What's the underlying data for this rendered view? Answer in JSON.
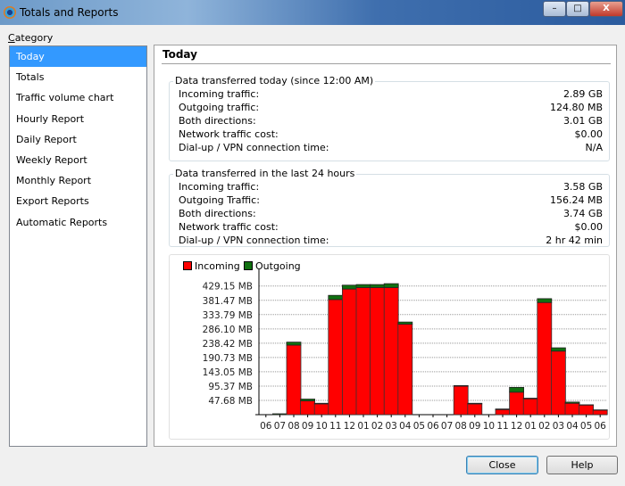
{
  "window": {
    "title": "Totals and Reports",
    "minimize": "–",
    "maximize": "□",
    "close": "X"
  },
  "sidebar": {
    "label_first": "C",
    "label_rest": "ategory",
    "items": [
      "Today",
      "Totals",
      "Traffic volume chart",
      "Hourly Report",
      "Daily Report",
      "Weekly Report",
      "Monthly Report",
      "Export Reports",
      "Automatic Reports"
    ],
    "selected": 0
  },
  "panel": {
    "title": "Today",
    "today": {
      "title": "Data transferred today (since 12:00 AM)",
      "rows": [
        [
          "Incoming traffic:",
          "2.89 GB"
        ],
        [
          "Outgoing traffic:",
          "124.80 MB"
        ],
        [
          "Both directions:",
          "3.01 GB"
        ],
        [
          "Network traffic cost:",
          "$0.00"
        ],
        [
          "Dial-up / VPN connection time:",
          "N/A"
        ]
      ]
    },
    "last24": {
      "title": "Data transferred in the last 24 hours",
      "rows": [
        [
          "Incoming traffic:",
          "3.58 GB"
        ],
        [
          "Outgoing Traffic:",
          "156.24 MB"
        ],
        [
          "Both directions:",
          "3.74 GB"
        ],
        [
          "Network traffic cost:",
          "$0.00"
        ],
        [
          "Dial-up / VPN connection time:",
          "2 hr 42 min"
        ]
      ]
    }
  },
  "colors": {
    "incoming": "#ff0000",
    "outgoing": "#107010"
  },
  "chart_data": {
    "type": "bar",
    "stacked": true,
    "title": "",
    "xlabel": "",
    "ylabel": "",
    "legend": [
      "Incoming",
      "Outgoing"
    ],
    "legend_position": "top-left",
    "categories": [
      "06",
      "07",
      "08",
      "09",
      "10",
      "11",
      "12",
      "01",
      "02",
      "03",
      "04",
      "05",
      "06",
      "07",
      "08",
      "09",
      "10",
      "11",
      "12",
      "01",
      "02",
      "03",
      "04",
      "05",
      "06"
    ],
    "series": [
      {
        "name": "Incoming",
        "values": [
          0,
          0,
          232,
          46,
          36,
          384,
          419,
          424,
          424,
          424,
          302,
          0,
          0,
          0,
          95,
          36,
          0,
          17,
          75,
          53,
          374,
          212,
          38,
          32,
          15
        ]
      },
      {
        "name": "Outgoing",
        "values": [
          0,
          3,
          10,
          6,
          2,
          14,
          13,
          10,
          10,
          13,
          7,
          0,
          0,
          0,
          2,
          2,
          0,
          2,
          16,
          2,
          13,
          11,
          4,
          1,
          1
        ]
      }
    ],
    "yticks": [
      47.68,
      95.37,
      143.05,
      190.73,
      238.42,
      286.1,
      333.79,
      381.47,
      429.15
    ],
    "ytick_labels": [
      "47.68 MB",
      "95.37 MB",
      "143.05 MB",
      "190.73 MB",
      "238.42 MB",
      "286.10 MB",
      "333.79 MB",
      "381.47 MB",
      "429.15 MB"
    ],
    "ylim": [
      0,
      467
    ],
    "grid": true
  },
  "buttons": {
    "close": "Close",
    "help": "Help"
  }
}
